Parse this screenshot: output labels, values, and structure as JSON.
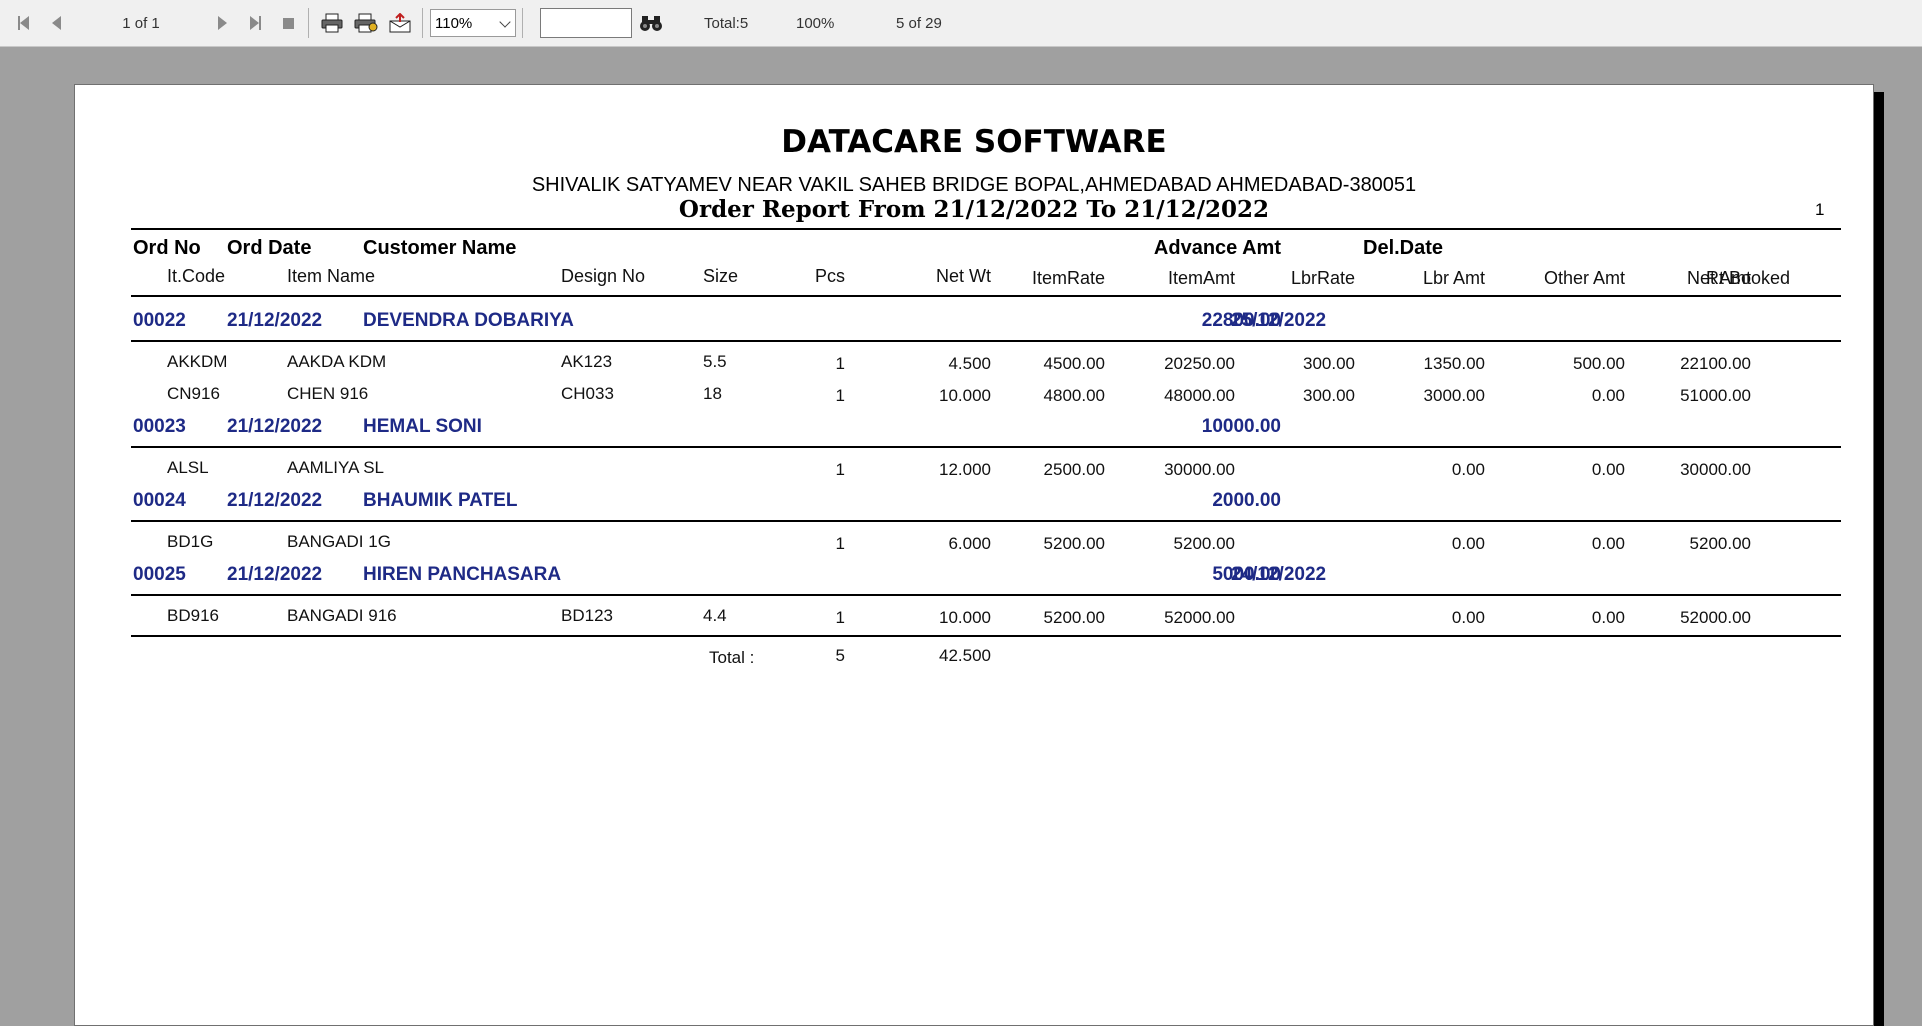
{
  "toolbar": {
    "page_indicator": "1 of 1",
    "zoom_value": "110%",
    "search_value": "",
    "total_label": "Total:5",
    "percent_label": "100%",
    "record_label": "5 of 29"
  },
  "report": {
    "company": "DATACARE SOFTWARE",
    "address": "SHIVALIK SATYAMEV NEAR VAKIL SAHEB BRIDGE BOPAL,AHMEDABAD AHMEDABAD-380051",
    "title": "Order Report From 21/12/2022 To 21/12/2022",
    "page_number": "1",
    "group_headers": {
      "ord_no": "Ord No",
      "ord_date": "Ord Date",
      "customer_name": "Customer Name",
      "advance_amt": "Advance Amt",
      "del_date": "Del.Date"
    },
    "item_headers": {
      "it_code": "It.Code",
      "item_name": "Item Name",
      "design_no": "Design No",
      "size": "Size",
      "pcs": "Pcs",
      "net_wt": "Net Wt",
      "item_rate": "ItemRate",
      "item_amt": "ItemAmt",
      "lbr_rate": "LbrRate",
      "lbr_amt": "Lbr Amt",
      "other_amt": "Other Amt",
      "net_amt": "Net Amt",
      "rt_booked": "Rt Booked"
    },
    "orders": [
      {
        "ord_no": "00022",
        "ord_date": "21/12/2022",
        "customer": "DEVENDRA DOBARIYA",
        "advance": "22800.00",
        "del_date": "25/12/2022",
        "items": [
          {
            "code": "AKKDM",
            "name": "AAKDA KDM",
            "design": "AK123",
            "size": "5.5",
            "pcs": "1",
            "net_wt": "4.500",
            "item_rate": "4500.00",
            "item_amt": "20250.00",
            "lbr_rate": "300.00",
            "lbr_amt": "1350.00",
            "other_amt": "500.00",
            "net_amt": "22100.00"
          },
          {
            "code": "CN916",
            "name": "CHEN 916",
            "design": "CH033",
            "size": "18",
            "pcs": "1",
            "net_wt": "10.000",
            "item_rate": "4800.00",
            "item_amt": "48000.00",
            "lbr_rate": "300.00",
            "lbr_amt": "3000.00",
            "other_amt": "0.00",
            "net_amt": "51000.00"
          }
        ]
      },
      {
        "ord_no": "00023",
        "ord_date": "21/12/2022",
        "customer": "HEMAL SONI",
        "advance": "10000.00",
        "del_date": "",
        "items": [
          {
            "code": "ALSL",
            "name": "AAMLIYA SL",
            "design": "",
            "size": "",
            "pcs": "1",
            "net_wt": "12.000",
            "item_rate": "2500.00",
            "item_amt": "30000.00",
            "lbr_rate": "",
            "lbr_amt": "0.00",
            "other_amt": "0.00",
            "net_amt": "30000.00"
          }
        ]
      },
      {
        "ord_no": "00024",
        "ord_date": "21/12/2022",
        "customer": "BHAUMIK PATEL",
        "advance": "2000.00",
        "del_date": "",
        "items": [
          {
            "code": "BD1G",
            "name": "BANGADI 1G",
            "design": "",
            "size": "",
            "pcs": "1",
            "net_wt": "6.000",
            "item_rate": "5200.00",
            "item_amt": "5200.00",
            "lbr_rate": "",
            "lbr_amt": "0.00",
            "other_amt": "0.00",
            "net_amt": "5200.00"
          }
        ]
      },
      {
        "ord_no": "00025",
        "ord_date": "21/12/2022",
        "customer": "HIREN PANCHASARA",
        "advance": "5000.00",
        "del_date": "24/12/2022",
        "items": [
          {
            "code": "BD916",
            "name": "BANGADI 916",
            "design": "BD123",
            "size": "4.4",
            "pcs": "1",
            "net_wt": "10.000",
            "item_rate": "5200.00",
            "item_amt": "52000.00",
            "lbr_rate": "",
            "lbr_amt": "0.00",
            "other_amt": "0.00",
            "net_amt": "52000.00"
          }
        ]
      }
    ],
    "totals": {
      "label": "Total :",
      "pcs": "5",
      "net_wt": "42.500"
    }
  }
}
